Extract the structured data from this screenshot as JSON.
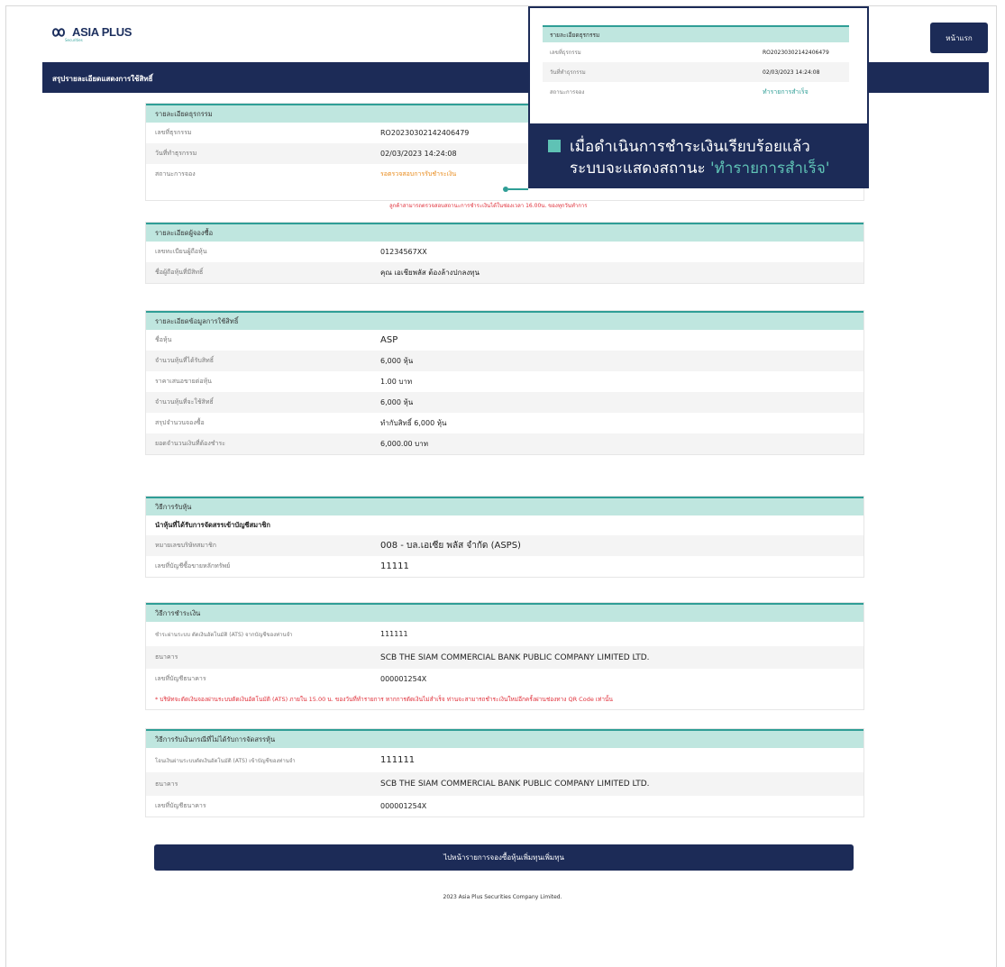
{
  "brand": {
    "name": "ASIA PLUS",
    "sub": "Securities"
  },
  "header": {
    "home_button": "หน้าแรก"
  },
  "navbar": {
    "title": "สรุปรายละเอียดแสดงการใช้สิทธิ์"
  },
  "transaction": {
    "heading": "รายละเอียดธุรกรรม",
    "rows": [
      {
        "label": "เลขที่ธุรกรรม",
        "value": "RO2023030214240647​9"
      },
      {
        "label": "วันที่ทำธุรกรรม",
        "value": "02/03/2023 14:24:08"
      },
      {
        "label": "สถานะการจอง",
        "value": "รอตรวจสอบการรับชำระเงิน"
      }
    ],
    "status_note": "ลูกค้าสามารถตรวจสอบสถานะการชำระเงินได้ในช่องเวลา 16.00น. ของทุกวันทำการ"
  },
  "customer": {
    "heading": "รายละเอียดผู้จองซื้อ",
    "rows": [
      {
        "label": "เลขทะเบียนผู้ถือหุ้น",
        "value": "0123456​7XX"
      },
      {
        "label": "ชื่อผู้ถือหุ้นที่มีสิทธิ์",
        "value": "คุณ เอเชียพลัส ต้องล้างปกลงทุน"
      }
    ]
  },
  "rights": {
    "heading": "รายละเอียดข้อมูลการใช้สิทธิ์",
    "rows": [
      {
        "label": "ชื่อหุ้น",
        "value": "ASP"
      },
      {
        "label": "จำนวนหุ้นที่ได้รับสิทธิ์",
        "value": "6,000 หุ้น"
      },
      {
        "label": "ราคาเสนอขายต่อหุ้น",
        "value": "1.00 บาท"
      },
      {
        "label": "จำนวนหุ้นที่จะใช้สิทธิ์",
        "value": "6,000 หุ้น"
      },
      {
        "label": "สรุปจำนวนจองซื้อ",
        "value": "ทำกับสิทธิ์ 6,000 หุ้น"
      },
      {
        "label": "ยอดจำนวนเงินที่ต้องชำระ",
        "value": "6,000.00 บาท"
      }
    ]
  },
  "share_method": {
    "heading": "วิธีการรับหุ้น",
    "sub_heading": "นำหุ้นที่ได้รับการจัดสรรเข้าบัญชีสมาชิก",
    "rows": [
      {
        "label": "หมายเลขบริษัทสมาชิก",
        "value": "008 - บล.เอเซีย พลัส จำกัด (ASPS)"
      },
      {
        "label": "เลขที่บัญชีซื้อขายหลักทรัพย์",
        "value": "11111"
      }
    ]
  },
  "payment": {
    "heading": "วิธีการชำระเงิน",
    "rows": [
      {
        "label": "ชำระผ่านระบบ ตัดเงินอัตโนมัติ (ATS) จากบัญชีของท่านจำ",
        "value": "111111"
      },
      {
        "label": "ธนาคาร",
        "value": "SCB THE SIAM COMMERCIAL BANK PUBLIC COMPANY LIMITED LTD."
      },
      {
        "label": "เลขที่บัญชีธนาคาร",
        "value": "000001254X"
      }
    ],
    "note": "* บริษัทจะตัดเงินจองผ่านระบบตัดเงินอัตโนมัติ (ATS) ภายใน 15.00 น. ของวันที่ทำรายการ หากการตัดเงินไม่สำเร็จ ท่านจะสามารถชำระเงินใหม่อีกครั้งผ่านช่องทาง QR Code เท่านั้น"
  },
  "refund": {
    "heading": "วิธีการรับเงินกรณีที่ไม่ได้รับการจัดสรรหุ้น",
    "rows": [
      {
        "label": "โอนเงินผ่านระบบตัดเงินอัตโนมัติ (ATS) เข้าบัญชีของท่านจำ",
        "value": "111111"
      },
      {
        "label": "ธนาคาร",
        "value": "SCB THE SIAM COMMERCIAL BANK PUBLIC COMPANY LIMITED LTD."
      },
      {
        "label": "เลขที่บัญชีธนาคาร",
        "value": "000001254X"
      }
    ]
  },
  "confirm_button": "ไปหน้ารายการจองซื้อหุ้นเพิ่มทุนเพิ่มทุน",
  "footer": "2023 Asia Plus Securities Company Limited.",
  "popup": {
    "heading": "รายละเอียดธุรกรรม",
    "rows": [
      {
        "label": "เลขที่ธุรกรรม",
        "value": "RO2023030214240647​9"
      },
      {
        "label": "วันที่ทำธุรกรรม",
        "value": "02/03/2023 14:24:08"
      },
      {
        "label": "สถานะการจอง",
        "value": "ทำรายการสำเร็จ"
      }
    ]
  },
  "callout": {
    "line1": "เมื่อดำเนินการชำระเงินเรียบร้อยแล้ว",
    "line2_prefix": "ระบบจะแสดงสถานะ",
    "line2_highlight": "'ทำรายการสำเร็จ'"
  }
}
